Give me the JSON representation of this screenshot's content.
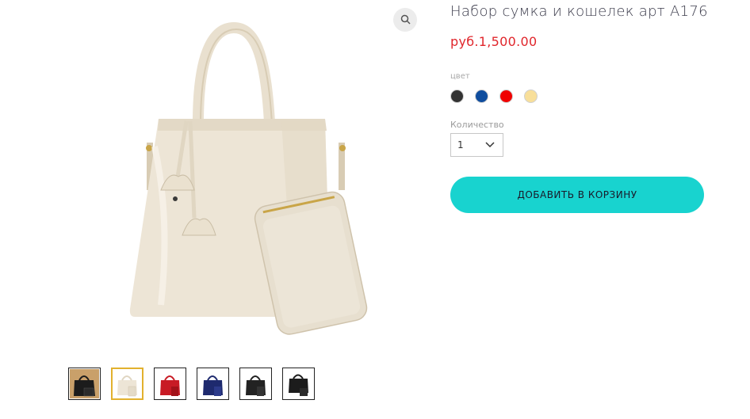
{
  "product": {
    "title": "Набор сумка и кошелек арт A176",
    "price": "руб.1,500.00",
    "color_label": "цвет",
    "colors": [
      "#333333",
      "#0f4d9e",
      "#f00000",
      "#f8df9a"
    ],
    "quantity_label": "Количество",
    "quantity_value": "1",
    "add_to_cart_label": "ДОБАВИТЬ В КОРЗИНУ"
  },
  "thumbnails": [
    {
      "color": "black"
    },
    {
      "color": "beige",
      "selected": true
    },
    {
      "color": "red"
    },
    {
      "color": "blue"
    },
    {
      "color": "black"
    },
    {
      "color": "black"
    }
  ],
  "icons": {
    "zoom": "magnifier-icon",
    "dropdown": "chevron-down-icon"
  }
}
